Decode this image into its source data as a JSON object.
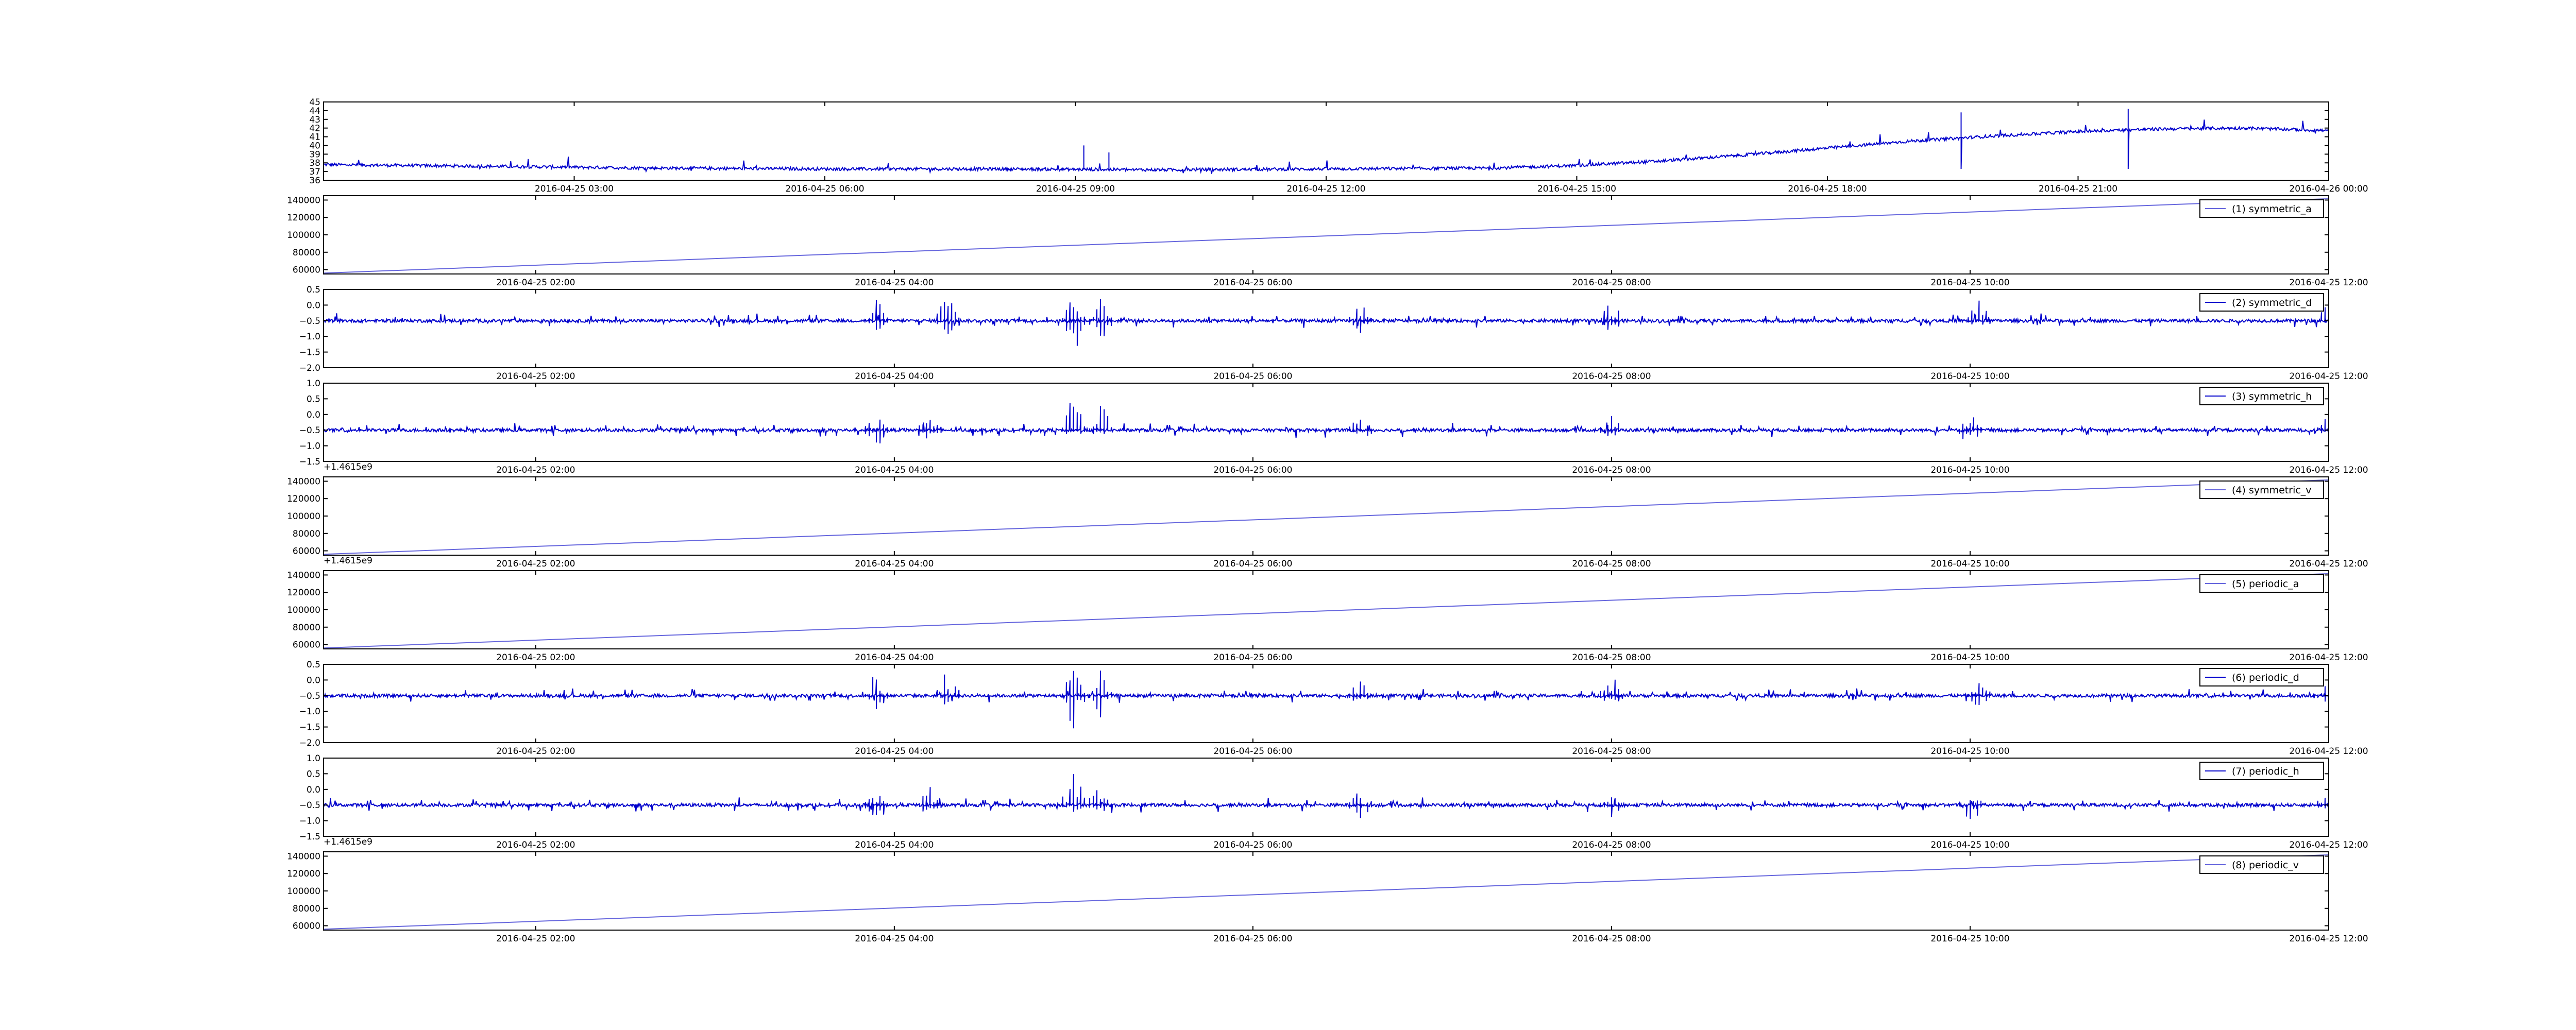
{
  "chart_data": [
    {
      "type": "line",
      "title": "",
      "xlabel": "",
      "ylabel": "",
      "x_range": [
        "2016-04-25 00:00",
        "2016-04-26 00:00"
      ],
      "x_tick_labels": [
        "2016-04-25 03:00",
        "2016-04-25 06:00",
        "2016-04-25 09:00",
        "2016-04-25 12:00",
        "2016-04-25 15:00",
        "2016-04-25 18:00",
        "2016-04-25 21:00",
        "2016-04-26 00:00"
      ],
      "ylim": [
        36,
        45
      ],
      "y_ticks": [
        36,
        37,
        38,
        39,
        40,
        41,
        42,
        43,
        44,
        45
      ],
      "y_tick_labels": [
        "36",
        "37",
        "38",
        "39",
        "40",
        "41",
        "42",
        "43",
        "44",
        "45"
      ],
      "grid": false,
      "series": [
        {
          "color": "#0000cc",
          "x": [
            "2016-04-25 00:00",
            "2016-04-25 02:00",
            "2016-04-25 04:00",
            "2016-04-25 06:00",
            "2016-04-25 08:00",
            "2016-04-25 10:00",
            "2016-04-25 12:00",
            "2016-04-25 14:00",
            "2016-04-25 15:00",
            "2016-04-25 16:00",
            "2016-04-25 17:00",
            "2016-04-25 18:00",
            "2016-04-25 19:00",
            "2016-04-25 20:00",
            "2016-04-25 21:00",
            "2016-04-25 22:00",
            "2016-04-25 23:00",
            "2016-04-26 00:00"
          ],
          "values": [
            37.8,
            37.6,
            37.4,
            37.3,
            37.3,
            37.2,
            37.3,
            37.4,
            37.7,
            38.2,
            38.9,
            39.7,
            40.5,
            41.1,
            41.6,
            41.9,
            42.0,
            41.7
          ]
        }
      ]
    },
    {
      "type": "line",
      "x_range": [
        "2016-04-25 00:49",
        "2016-04-25 12:00"
      ],
      "x_tick_labels": [
        "2016-04-25 02:00",
        "2016-04-25 04:00",
        "2016-04-25 06:00",
        "2016-04-25 08:00",
        "2016-04-25 10:00",
        "2016-04-25 12:00"
      ],
      "ylim": [
        55000,
        145000
      ],
      "y_ticks": [
        60000,
        80000,
        100000,
        120000,
        140000
      ],
      "y_tick_labels": [
        "60000",
        "80000",
        "100000",
        "120000",
        "140000"
      ],
      "grid": false,
      "legend_position": "top-right",
      "series": [
        {
          "name": "(1) symmetric_a",
          "color": "#6666dd",
          "x": [
            "2016-04-25 00:49",
            "2016-04-25 12:00"
          ],
          "values": [
            56000,
            141500
          ]
        }
      ]
    },
    {
      "type": "line",
      "x_range": [
        "2016-04-25 00:49",
        "2016-04-25 12:00"
      ],
      "x_tick_labels": [
        "2016-04-25 02:00",
        "2016-04-25 04:00",
        "2016-04-25 06:00",
        "2016-04-25 08:00",
        "2016-04-25 10:00",
        "2016-04-25 12:00"
      ],
      "ylim": [
        -2.0,
        0.5
      ],
      "y_ticks": [
        -2.0,
        -1.5,
        -1.0,
        -0.5,
        0.0,
        0.5
      ],
      "y_tick_labels": [
        "−2.0",
        "−1.5",
        "−1.0",
        "−0.5",
        "0.0",
        "0.5"
      ],
      "grid": false,
      "legend_position": "top-right",
      "series": [
        {
          "name": "(2) symmetric_d",
          "color": "#0000cc",
          "baseline": -0.5,
          "noise": 0.05,
          "spikes": [
            [
              3.9,
              0.3,
              -1.0
            ],
            [
              4.3,
              0.5,
              -1.0
            ],
            [
              5.0,
              0.4,
              -1.6
            ],
            [
              5.15,
              0.3,
              -1.2
            ],
            [
              6.6,
              0.1,
              -0.9
            ],
            [
              8.0,
              0.2,
              -0.9
            ],
            [
              10.05,
              0.2,
              -0.9
            ],
            [
              11.5,
              0.1,
              -0.8
            ]
          ]
        }
      ]
    },
    {
      "type": "line",
      "x_range": [
        "2016-04-25 00:49",
        "2016-04-25 12:00"
      ],
      "x_tick_labels": [
        "2016-04-25 02:00",
        "2016-04-25 04:00",
        "2016-04-25 06:00",
        "2016-04-25 08:00",
        "2016-04-25 10:00",
        "2016-04-25 12:00"
      ],
      "x_offset_label": "+1.4615e9",
      "ylim": [
        -1.5,
        1.0
      ],
      "y_ticks": [
        -1.5,
        -1.0,
        -0.5,
        0.0,
        0.5,
        1.0
      ],
      "y_tick_labels": [
        "−1.5",
        "−1.0",
        "−0.5",
        "0.0",
        "0.5",
        "1.0"
      ],
      "grid": false,
      "legend_position": "top-right",
      "series": [
        {
          "name": "(3) symmetric_h",
          "color": "#0000cc",
          "baseline": -0.5,
          "noise": 0.05,
          "spikes": [
            [
              3.9,
              0.0,
              -1.2
            ],
            [
              4.2,
              0.1,
              -1.0
            ],
            [
              5.0,
              0.7,
              -0.8
            ],
            [
              5.15,
              0.4,
              -0.9
            ],
            [
              6.6,
              0.0,
              -1.0
            ],
            [
              8.0,
              0.0,
              -0.9
            ],
            [
              10.0,
              0.1,
              -1.2
            ],
            [
              12.0,
              0.1,
              -0.7
            ]
          ]
        }
      ]
    },
    {
      "type": "line",
      "x_range": [
        "2016-04-25 00:49",
        "2016-04-25 12:00"
      ],
      "x_tick_labels": [
        "2016-04-25 02:00",
        "2016-04-25 04:00",
        "2016-04-25 06:00",
        "2016-04-25 08:00",
        "2016-04-25 10:00",
        "2016-04-25 12:00"
      ],
      "x_offset_label": "+1.4615e9",
      "ylim": [
        55000,
        145000
      ],
      "y_ticks": [
        60000,
        80000,
        100000,
        120000,
        140000
      ],
      "y_tick_labels": [
        "60000",
        "80000",
        "100000",
        "120000",
        "140000"
      ],
      "grid": false,
      "legend_position": "top-right",
      "series": [
        {
          "name": "(4) symmetric_v",
          "color": "#6666dd",
          "x": [
            "2016-04-25 00:49",
            "2016-04-25 12:00"
          ],
          "values": [
            56000,
            141500
          ]
        }
      ]
    },
    {
      "type": "line",
      "x_range": [
        "2016-04-25 00:49",
        "2016-04-25 12:00"
      ],
      "x_tick_labels": [
        "2016-04-25 02:00",
        "2016-04-25 04:00",
        "2016-04-25 06:00",
        "2016-04-25 08:00",
        "2016-04-25 10:00",
        "2016-04-25 12:00"
      ],
      "ylim": [
        55000,
        145000
      ],
      "y_ticks": [
        60000,
        80000,
        100000,
        120000,
        140000
      ],
      "y_tick_labels": [
        "60000",
        "80000",
        "100000",
        "120000",
        "140000"
      ],
      "grid": false,
      "legend_position": "top-right",
      "series": [
        {
          "name": "(5) periodic_a",
          "color": "#6666dd",
          "x": [
            "2016-04-25 00:49",
            "2016-04-25 12:00"
          ],
          "values": [
            56000,
            141500
          ]
        }
      ]
    },
    {
      "type": "line",
      "x_range": [
        "2016-04-25 00:49",
        "2016-04-25 12:00"
      ],
      "x_tick_labels": [
        "2016-04-25 02:00",
        "2016-04-25 04:00",
        "2016-04-25 06:00",
        "2016-04-25 08:00",
        "2016-04-25 10:00",
        "2016-04-25 12:00"
      ],
      "ylim": [
        -2.0,
        0.5
      ],
      "y_ticks": [
        -2.0,
        -1.5,
        -1.0,
        -0.5,
        0.0,
        0.5
      ],
      "y_tick_labels": [
        "−2.0",
        "−1.5",
        "−1.0",
        "−0.5",
        "0.0",
        "0.5"
      ],
      "grid": false,
      "legend_position": "top-right",
      "series": [
        {
          "name": "(6) periodic_d",
          "color": "#0000cc",
          "baseline": -0.5,
          "noise": 0.05,
          "spikes": [
            [
              3.9,
              0.3,
              -1.0
            ],
            [
              4.3,
              0.5,
              -1.0
            ],
            [
              5.0,
              0.4,
              -1.6
            ],
            [
              5.15,
              0.3,
              -1.2
            ],
            [
              6.6,
              0.1,
              -0.9
            ],
            [
              8.0,
              0.2,
              -0.9
            ],
            [
              10.05,
              0.2,
              -0.9
            ],
            [
              11.5,
              0.1,
              -0.8
            ]
          ]
        }
      ]
    },
    {
      "type": "line",
      "x_range": [
        "2016-04-25 00:49",
        "2016-04-25 12:00"
      ],
      "x_tick_labels": [
        "2016-04-25 02:00",
        "2016-04-25 04:00",
        "2016-04-25 06:00",
        "2016-04-25 08:00",
        "2016-04-25 10:00",
        "2016-04-25 12:00"
      ],
      "x_offset_label": "+1.4615e9",
      "ylim": [
        -1.5,
        1.0
      ],
      "y_ticks": [
        -1.5,
        -1.0,
        -0.5,
        0.0,
        0.5,
        1.0
      ],
      "y_tick_labels": [
        "−1.5",
        "−1.0",
        "−0.5",
        "0.0",
        "0.5",
        "1.0"
      ],
      "grid": false,
      "legend_position": "top-right",
      "series": [
        {
          "name": "(7) periodic_h",
          "color": "#0000cc",
          "baseline": -0.5,
          "noise": 0.05,
          "spikes": [
            [
              3.9,
              0.0,
              -1.2
            ],
            [
              4.2,
              0.1,
              -1.0
            ],
            [
              5.0,
              0.7,
              -0.8
            ],
            [
              5.15,
              0.4,
              -0.9
            ],
            [
              6.6,
              0.0,
              -1.0
            ],
            [
              8.0,
              0.0,
              -0.9
            ],
            [
              10.0,
              0.1,
              -1.2
            ],
            [
              12.0,
              0.1,
              -0.7
            ]
          ]
        }
      ]
    },
    {
      "type": "line",
      "x_range": [
        "2016-04-25 00:49",
        "2016-04-25 12:00"
      ],
      "x_tick_labels": [
        "2016-04-25 02:00",
        "2016-04-25 04:00",
        "2016-04-25 06:00",
        "2016-04-25 08:00",
        "2016-04-25 10:00",
        "2016-04-25 12:00"
      ],
      "ylim": [
        55000,
        145000
      ],
      "y_ticks": [
        60000,
        80000,
        100000,
        120000,
        140000
      ],
      "y_tick_labels": [
        "60000",
        "80000",
        "100000",
        "120000",
        "140000"
      ],
      "grid": false,
      "legend_position": "top-right",
      "series": [
        {
          "name": "(8) periodic_v",
          "color": "#6666dd",
          "x": [
            "2016-04-25 00:49",
            "2016-04-25 12:00"
          ],
          "values": [
            56000,
            141500
          ]
        }
      ]
    }
  ]
}
